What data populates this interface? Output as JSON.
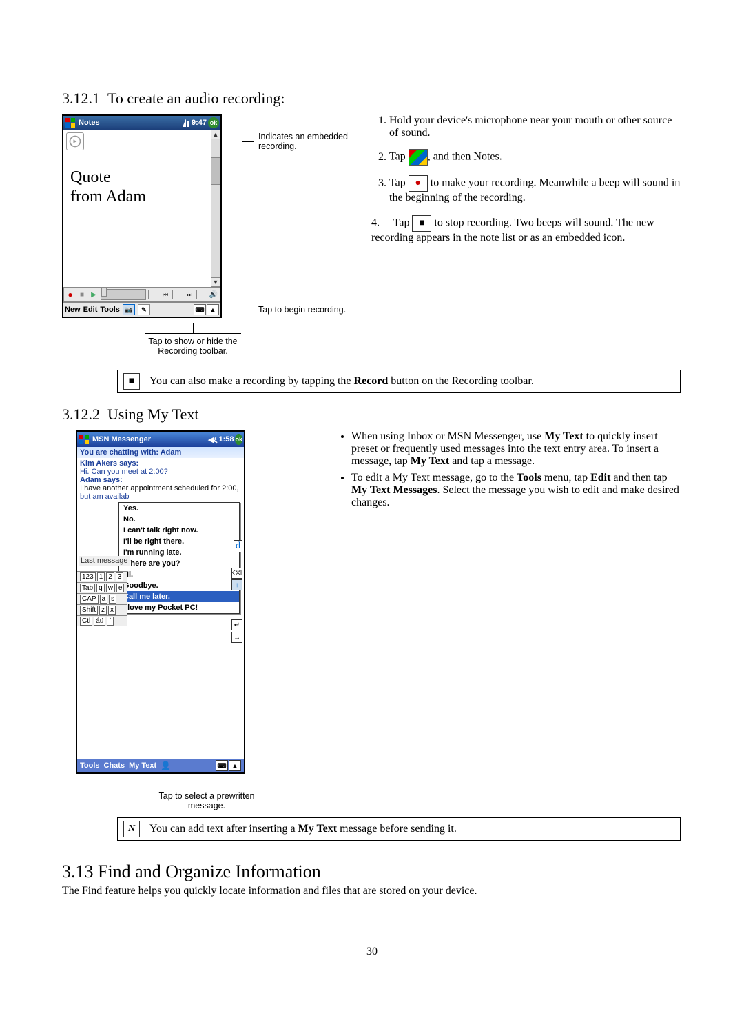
{
  "section1": {
    "number": "3.12.1",
    "title": "To create an audio recording:",
    "callouts": {
      "embedded": "Indicates an embedded recording.",
      "tapBegin": "Tap to begin recording.",
      "showHide": "Tap to show or hide the Recording toolbar."
    },
    "device": {
      "app": "Notes",
      "time": "9:47",
      "ok": "ok",
      "ink1": "Quote",
      "ink2": "from Adam",
      "menu": {
        "new": "New",
        "edit": "Edit",
        "tools": "Tools"
      }
    },
    "steps": {
      "s1": "Hold your device's microphone near your mouth or other source of sound.",
      "s2a": "Tap",
      "s2b": ", and then Notes.",
      "s3a": "Tap",
      "s3b": "to make your recording. Meanwhile a beep will sound in the beginning of the recording.",
      "s4num": "4.",
      "s4a": "Tap",
      "s4b": "to stop recording. Two beeps will sound. The new recording appears in the note list or as an embedded icon."
    },
    "tip": "You can also make a recording by tapping the Record button on the Recording toolbar.",
    "tipBold": "Record"
  },
  "section2": {
    "number": "3.12.2",
    "title": "Using My Text",
    "device": {
      "app": "MSN Messenger",
      "time": "1:58",
      "ok": "ok",
      "banner": "You are chatting with: Adam",
      "kimName": "Kim Akers says:",
      "kimLine": "Hi. Can you meet at 2:00?",
      "adamName": "Adam says:",
      "adamLine": "I have another appointment scheduled for 2:00,",
      "adamLine2": "but am availab",
      "lastMsg": "Last message",
      "sendChar": "d",
      "popup": {
        "p1": "Yes.",
        "p2": "No.",
        "p3": "I can't talk right now.",
        "p4": "I'll be right there.",
        "p5": "I'm running late.",
        "p6": "Where are you?",
        "p7": "Hi.",
        "p8": "Goodbye.",
        "p9": "Call me later.",
        "p10": "I love my Pocket PC!"
      },
      "kbRows": {
        "r1a": "123",
        "r1b": "1",
        "r1c": "2",
        "r1d": "3",
        "r2a": "Tab",
        "r2b": "q",
        "r2c": "w",
        "r2d": "e",
        "r3a": "CAP",
        "r3b": "a",
        "r3c": "s",
        "r4a": "Shift",
        "r4b": "z",
        "r4c": "x",
        "r5a": "Ctl",
        "r5b": "áü",
        "r5c": "`"
      },
      "menu": {
        "tools": "Tools",
        "chats": "Chats",
        "mytext": "My Text"
      }
    },
    "callout": "Tap to select a prewritten message.",
    "bullets": {
      "b1a": "When using Inbox or MSN Messenger, use ",
      "b1bold1": "My Text",
      "b1b": " to quickly insert preset or frequently used messages into the text entry area. To insert a message, tap ",
      "b1bold2": "My Text",
      "b1c": " and tap a message.",
      "b2a": "To edit a My Text message, go to the ",
      "b2bold1": "Tools",
      "b2b": " menu, tap ",
      "b2bold2": "Edit",
      "b2c": " and then tap ",
      "b2bold3": "My Text Messages",
      "b2d": ". Select the message you wish to edit and make desired changes."
    },
    "tip": "You can add text after inserting a My Text message before sending it.",
    "tipBold": "My Text"
  },
  "section3": {
    "number": "3.13",
    "title": "Find and Organize Information",
    "intro": "The Find feature helps you quickly locate information and files that are stored on your device."
  },
  "pageNumber": "30"
}
